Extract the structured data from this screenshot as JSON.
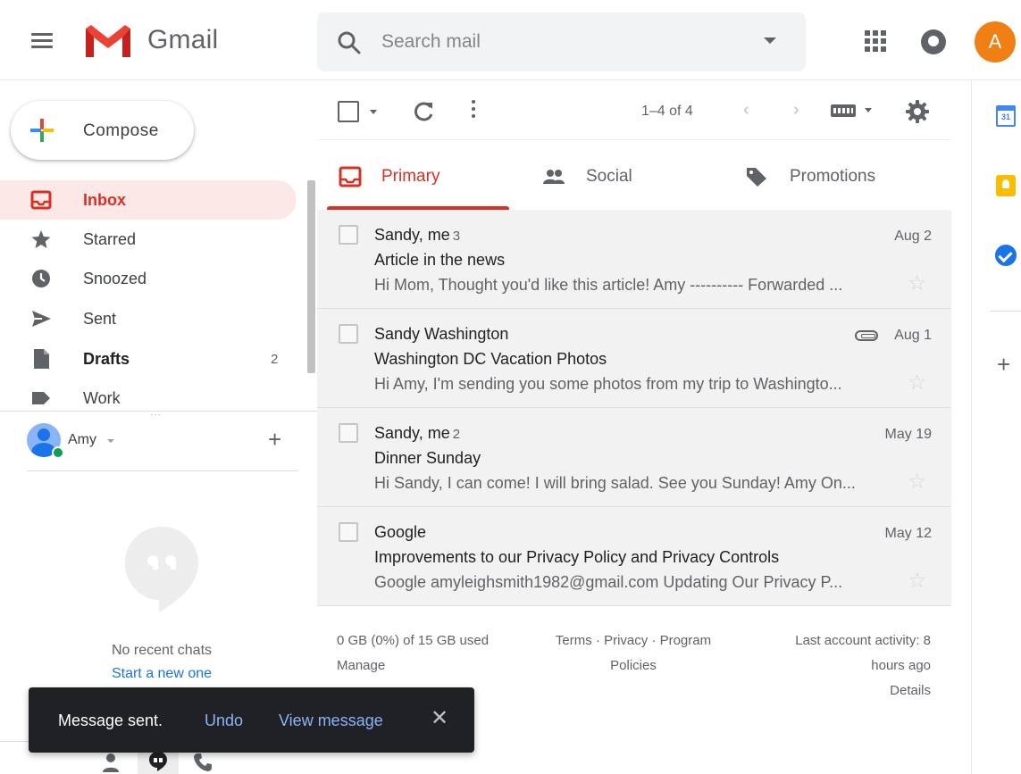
{
  "app": {
    "name": "Gmail"
  },
  "header": {
    "search_placeholder": "Search mail",
    "avatar_initial": "A",
    "avatar_color": "#f07f14"
  },
  "icons": {
    "menu": "hamburger-menu-icon",
    "search": "search-icon",
    "apps": "google-apps-icon",
    "notifications": "notifications-icon"
  },
  "compose": {
    "label": "Compose"
  },
  "sidebar": {
    "items": [
      {
        "label": "Inbox",
        "icon": "inbox-icon",
        "active": true,
        "count": ""
      },
      {
        "label": "Starred",
        "icon": "star-icon",
        "active": false,
        "count": ""
      },
      {
        "label": "Snoozed",
        "icon": "clock-icon",
        "active": false,
        "count": ""
      },
      {
        "label": "Sent",
        "icon": "send-icon",
        "active": false,
        "count": ""
      },
      {
        "label": "Drafts",
        "icon": "draft-icon",
        "active": false,
        "count": "2"
      },
      {
        "label": "Work",
        "icon": "label-icon",
        "active": false,
        "count": ""
      }
    ]
  },
  "hangouts": {
    "user_name": "Amy",
    "no_chats_text": "No recent chats",
    "start_chat_link": "Start a new one"
  },
  "toolbar": {
    "page_count": "1–4 of 4",
    "prev": "‹",
    "next": "›"
  },
  "tabs": [
    {
      "label": "Primary",
      "icon": "inbox-icon",
      "active": true
    },
    {
      "label": "Social",
      "icon": "people-icon",
      "active": false
    },
    {
      "label": "Promotions",
      "icon": "tag-icon",
      "active": false
    }
  ],
  "emails": [
    {
      "sender": "Sandy, me",
      "thread_count": "3",
      "subject": "Article in the news",
      "snippet": "Hi Mom, Thought you'd like this article! Amy ---------- Forwarded ...",
      "date": "Aug 2",
      "has_attachment": false
    },
    {
      "sender": "Sandy Washington",
      "thread_count": "",
      "subject": "Washington DC Vacation Photos",
      "snippet": "Hi Amy, I'm sending you some photos from my trip to Washingto...",
      "date": "Aug 1",
      "has_attachment": true
    },
    {
      "sender": "Sandy, me",
      "thread_count": "2",
      "subject": "Dinner Sunday",
      "snippet": "Hi Sandy, I can come! I will bring salad. See you Sunday! Amy On...",
      "date": "May 19",
      "has_attachment": false
    },
    {
      "sender": "Google",
      "thread_count": "",
      "subject": "Improvements to our Privacy Policy and Privacy Controls",
      "snippet": "Google amyleighsmith1982@gmail.com Updating Our Privacy P...",
      "date": "May 12",
      "has_attachment": false
    }
  ],
  "footer": {
    "storage": "0 GB (0%) of 15 GB used",
    "manage": "Manage",
    "terms": "Terms",
    "privacy": "Privacy",
    "program_policies_line1": "Program",
    "program_policies_line2": "Policies",
    "separator": "·",
    "activity_line1": "Last account activity: 8",
    "activity_line2": "hours ago",
    "details": "Details"
  },
  "side_panel": {
    "calendar_day": "31"
  },
  "snackbar": {
    "message": "Message sent.",
    "undo": "Undo",
    "view_message": "View message",
    "close": "✕"
  },
  "colors": {
    "accent_red": "#d93025",
    "active_bg": "#fce8e6",
    "link_blue": "#1a73e8",
    "row_bg": "#f2f2f2"
  }
}
